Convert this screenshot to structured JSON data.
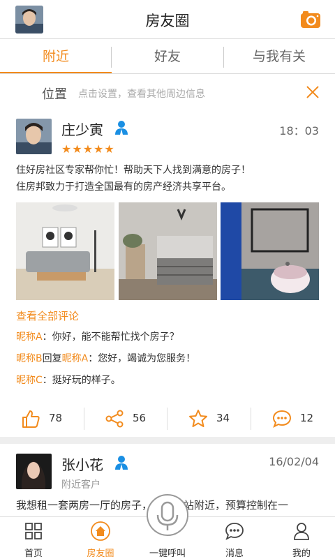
{
  "header": {
    "title": "房友圈",
    "avatar": "user-avatar",
    "camera_icon": "camera-icon"
  },
  "tabs": [
    {
      "label": "附近",
      "active": true
    },
    {
      "label": "好友",
      "active": false
    },
    {
      "label": "与我有关",
      "active": false
    }
  ],
  "location": {
    "label": "位置",
    "hint": "点击设置，查看其他周边信息",
    "close_icon": "close-icon"
  },
  "post1": {
    "name": "庄少寅",
    "time": "18：03",
    "stars": "★★★★★",
    "text_line1": "住好房社区专家帮你忙！帮助天下人找到满意的房子！",
    "text_line2": "住房邦致力于打造全国最有的房产经济共享平台。",
    "view_all": "查看全部评论",
    "comments": [
      {
        "nick": "昵称A",
        "sep": "：",
        "text": "你好，能不能帮忙找个房子？"
      },
      {
        "nick": "昵称B",
        "reply": "回复",
        "nick2": "昵称A",
        "sep": "：",
        "text": "您好，竭诚为您服务！"
      },
      {
        "nick": "昵称C",
        "sep": "：",
        "text": "挺好玩的样子。"
      }
    ],
    "actions": {
      "likes": "78",
      "shares": "56",
      "favorites": "34",
      "comments": "12"
    }
  },
  "post2": {
    "name": "张小花",
    "time": "16/02/04",
    "sub": "附近客户",
    "text": "我想租一套两房一厅的房子，在火车站附近，预算控制在一"
  },
  "tabbar": [
    {
      "label": "首页",
      "active": false
    },
    {
      "label": "房友圈",
      "active": true
    },
    {
      "label": "一键呼叫",
      "active": false
    },
    {
      "label": "消息",
      "active": false
    },
    {
      "label": "我的",
      "active": false
    }
  ],
  "colors": {
    "accent": "#f28b1d",
    "badge": "#1a8fe3"
  }
}
